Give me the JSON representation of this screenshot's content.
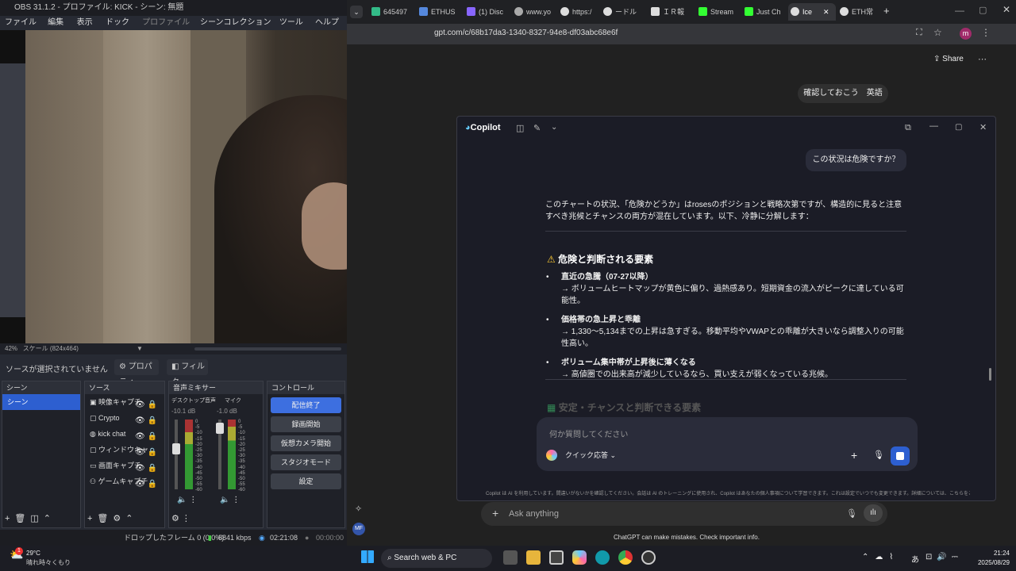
{
  "obs": {
    "title": "OBS 31.1.2 - プロファイル: KICK - シーン: 無題",
    "menu": [
      "ファイル(F)",
      "編集(E)",
      "表示(V)",
      "ドック(D)",
      "プロファイル(P)",
      "シーンコレクション(S)",
      "ツール(T)",
      "ヘルプ(H)"
    ],
    "zoom": "42%",
    "scale": "スケール (824x464)",
    "no_source": "ソースが選択されていません",
    "properties": "プロパティ",
    "filters": "フィルタ",
    "docks": {
      "scenes": {
        "title": "シーン",
        "items": [
          "シーン"
        ]
      },
      "sources": {
        "title": "ソース",
        "items": [
          "映像キャプチ",
          "Crypto",
          "kick chat",
          "ウィンドウキャ",
          "画面キャプチ",
          "ゲームキャプチ"
        ]
      },
      "mixer": {
        "title": "音声ミキサー",
        "channels": [
          {
            "name": "デスクトップ音声",
            "db": "-10.1 dB"
          },
          {
            "name": "マイク",
            "db": "-1.0 dB"
          }
        ],
        "scale": [
          "0",
          "-5",
          "-10",
          "-15",
          "-20",
          "-25",
          "-30",
          "-35",
          "-40",
          "-45",
          "-50",
          "-55",
          "-60"
        ]
      },
      "controls": {
        "title": "コントロール",
        "buttons": [
          "配信終了",
          "録画開始",
          "仮想カメラ開始",
          "スタジオモード",
          "設定"
        ]
      }
    },
    "status": {
      "dropped": "ドロップしたフレーム 0 (0.0%)",
      "bitrate": "8841 kbps",
      "stream_time": "02:21:08",
      "rec_time": "00:00:00"
    }
  },
  "browser": {
    "tabs": [
      "645497",
      "ETHUS",
      "(1) Disc",
      "www.yo",
      "https:/",
      "ードル",
      "ＩＲ報",
      "Stream",
      "Just Ch",
      "Ice",
      "ETH常"
    ],
    "url": "gpt.com/c/68b17da3-1340-8327-94e8-df03abc68e6f",
    "profile_initial": "m",
    "share": "Share",
    "user_pill": "確認しておこう　英語",
    "ask_placeholder": "Ask anything",
    "disclaimer": "ChatGPT can make mistakes. Check important info."
  },
  "copilot": {
    "title": "Copilot",
    "user_message": "この状況は危険ですか？",
    "intro": "このチャートの状況、「危険かどうか」はrosesのポジションと戦略次第ですが、構造的に見ると注意すべき兆候とチャンスの両方が混在しています。以下、冷静に分解します：",
    "section_title": "危険と判断される要素",
    "bullets": [
      {
        "head": "直近の急騰（07-27以降）",
        "body": "→ ボリュームヒートマップが黄色に偏り、過熱感あり。短期資金の流入がピークに達している可能性。"
      },
      {
        "head": "価格帯の急上昇と乖離",
        "body": "→ 1,330〜5,134までの上昇は急すぎる。移動平均やVWAPとの乖離が大きいなら調整入りの可能性高い。"
      },
      {
        "head": "ボリューム集中帯が上昇後に薄くなる",
        "body": "→ 高値圏での出来高が減少しているなら、買い支えが弱くなっている兆候。"
      }
    ],
    "next_section": "安定・チャンスと判断できる要素",
    "input_placeholder": "何か質問してください",
    "mode": "クイック応答",
    "footer": "Copilot は AI を利用しています。間違いがないかを確認してください。会話は AI のトレーニングに使用され、Copilot はあなたの個人事項について学習できます。これは設定でいつでも変更できます。詳細については、こちらをご覧ください。"
  },
  "taskbar": {
    "temp": "29°C",
    "weather": "晴れ時々くもり",
    "badge": "1",
    "search": "Search web & PC",
    "time": "21:24",
    "date": "2025/08/29",
    "ime": "あ"
  }
}
